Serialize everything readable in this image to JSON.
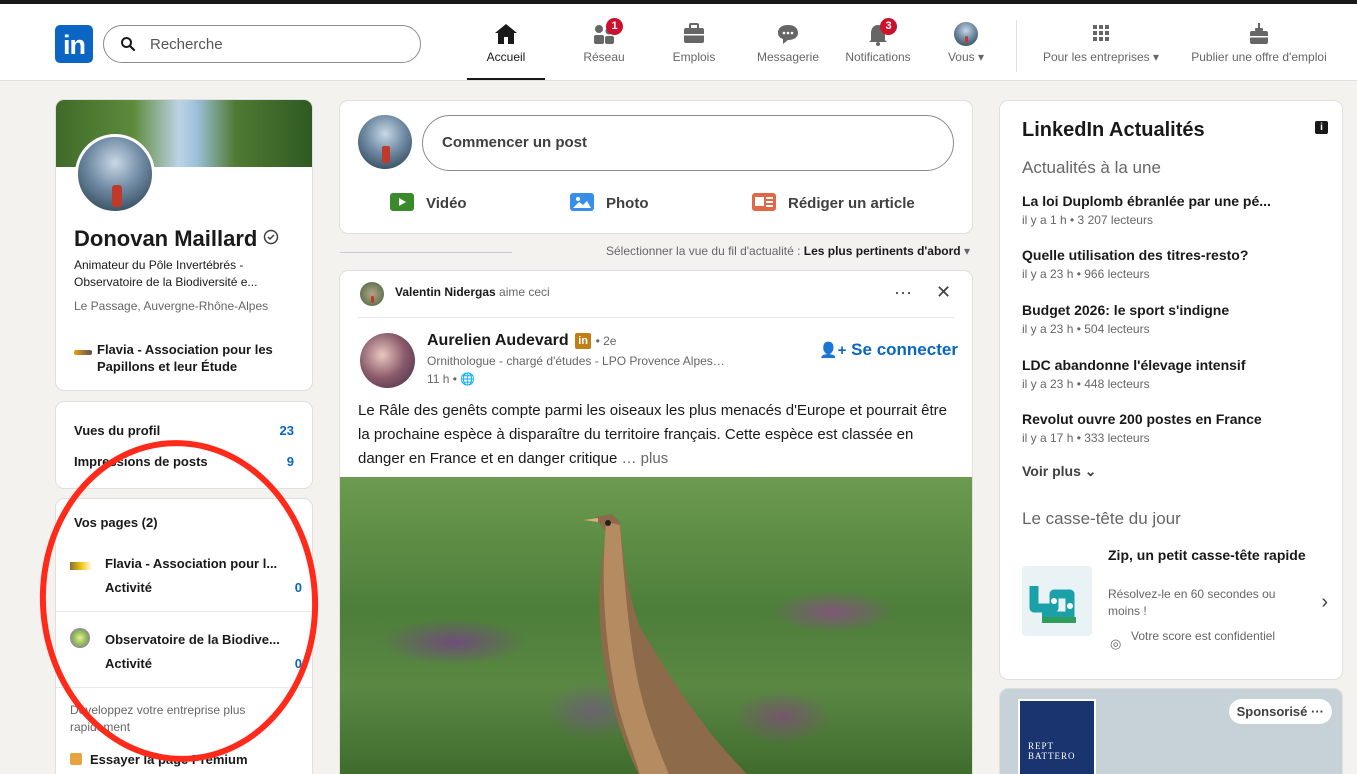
{
  "nav": {
    "search_placeholder": "Recherche",
    "items": [
      {
        "label": "Accueil",
        "icon": "home-icon"
      },
      {
        "label": "Réseau",
        "icon": "network-icon",
        "badge": "1"
      },
      {
        "label": "Emplois",
        "icon": "briefcase-icon"
      },
      {
        "label": "Messagerie",
        "icon": "message-icon"
      },
      {
        "label": "Notifications",
        "icon": "bell-icon",
        "badge": "3"
      },
      {
        "label": "Vous ▾",
        "icon": "avatar"
      },
      {
        "label": "Pour les entreprises ▾",
        "icon": "grid-icon"
      },
      {
        "label": "Publier une offre d'emploi",
        "icon": "post-job-icon"
      }
    ],
    "logo_text": "in",
    "accent": "#0a66c2"
  },
  "profile": {
    "name": "Donovan Maillard",
    "headline": "Animateur du Pôle Invertébrés - Observatoire de la Biodiversité e...",
    "location": "Le Passage, Auvergne-Rhône-Alpes",
    "org": "Flavia - Association pour les Papillons et leur Étude"
  },
  "stats": [
    {
      "label": "Vues du profil",
      "value": "23"
    },
    {
      "label": "Impressions de posts",
      "value": "9"
    }
  ],
  "pages": {
    "title": "Vos pages (2)",
    "items": [
      {
        "name": "Flavia - Association pour l...",
        "activity": "Activité",
        "count": "0"
      },
      {
        "name": "Observatoire de la Biodive...",
        "activity": "Activité",
        "count": "0"
      }
    ],
    "promo": "Développez votre entreprise plus rapidement",
    "premium": "Essayer la page Premium"
  },
  "composer": {
    "placeholder": "Commencer un post",
    "actions": [
      "Vidéo",
      "Photo",
      "Rédiger un article"
    ]
  },
  "feed_sort": {
    "label": "Sélectionner la vue du fil d'actualité : ",
    "value": "Les plus pertinents d'abord"
  },
  "post": {
    "social_actor": "Valentin Nidergas",
    "social_action": " aime ceci",
    "author": "Aurelien Audevard",
    "degree": "• 2e",
    "headline": "Ornithologue - chargé d'études - LPO Provence Alpes Cô...",
    "time": "11 h • 🌐",
    "connect": "Se connecter",
    "text": "Le Râle des genêts compte parmi les oiseaux les plus menacés d'Europe et pourrait être la prochaine espèce à disparaître du territoire français. Cette espèce est classée en danger en France et en danger critique",
    "more": "… plus",
    "more_icon": "···",
    "close_icon": "✕"
  },
  "news": {
    "title": "LinkedIn Actualités",
    "subtitle": "Actualités à la une",
    "items": [
      {
        "headline": "La loi Duplomb ébranlée par une pé...",
        "meta": "il y a 1 h • 3 207 lecteurs"
      },
      {
        "headline": "Quelle utilisation des titres-resto?",
        "meta": "il y a 23 h • 966 lecteurs"
      },
      {
        "headline": "Budget 2026: le sport s'indigne",
        "meta": "il y a 23 h • 504 lecteurs"
      },
      {
        "headline": "LDC abandonne l'élevage intensif",
        "meta": "il y a 23 h • 448 lecteurs"
      },
      {
        "headline": "Revolut ouvre 200 postes en France",
        "meta": "il y a 17 h • 333 lecteurs"
      }
    ],
    "see_more": "Voir plus",
    "puzzle_title": "Le casse-tête du jour",
    "puzzle_name": "Zip, un petit casse-tête rapide",
    "puzzle_desc": "Résolvez-le en 60 secondes ou moins !",
    "puzzle_score": "Votre score est confidentiel"
  },
  "ad": {
    "sponsored": "Sponsorisé ···",
    "logo_text": "REPT BATTERO"
  }
}
